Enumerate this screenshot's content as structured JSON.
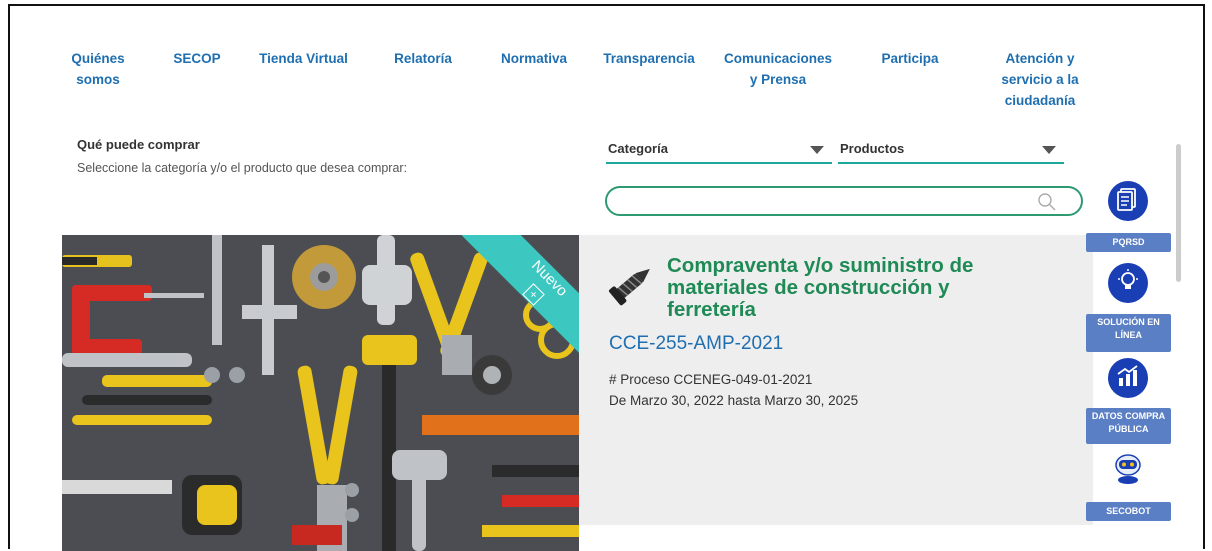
{
  "nav": {
    "items": [
      {
        "label": "Quiénes somos"
      },
      {
        "label": "SECOP"
      },
      {
        "label": "Tienda Virtual"
      },
      {
        "label": "Relatoría"
      },
      {
        "label": "Normativa"
      },
      {
        "label": "Transparencia"
      },
      {
        "label": "Comunicaciones y Prensa"
      },
      {
        "label": "Participa"
      },
      {
        "label": "Atención y servicio a la ciudadanía"
      }
    ]
  },
  "buy": {
    "title": "Qué puede comprar",
    "subtitle": "Seleccione la categoría y/o el producto que desea comprar:",
    "category_select": "Categoría",
    "products_select": "Productos",
    "search_value": ""
  },
  "featured": {
    "badge": "Nuevo",
    "title": "Compraventa y/o suministro de materiales de construcción y ferretería",
    "code": "CCE-255-AMP-2021",
    "process": "# Proceso CCENEG-049-01-2021",
    "dates": "De Marzo 30, 2022 hasta Marzo 30, 2025"
  },
  "sidebar": {
    "items": [
      {
        "label": "PQRSD",
        "icon": "document-icon"
      },
      {
        "label": "SOLUCIÓN EN LÍNEA",
        "icon": "lightbulb-icon"
      },
      {
        "label": "DATOS COMPRA PÚBLICA",
        "icon": "chart-icon"
      },
      {
        "label": "SECOBOT",
        "icon": "robot-icon"
      }
    ]
  },
  "colors": {
    "nav_link": "#1f6fb0",
    "title_green": "#1f8a55",
    "accent_teal": "#1aa89a",
    "sidebar_blue": "#1a3fb5",
    "sidebar_label": "#5b7fc4",
    "badge_teal": "#3cc7c0"
  }
}
